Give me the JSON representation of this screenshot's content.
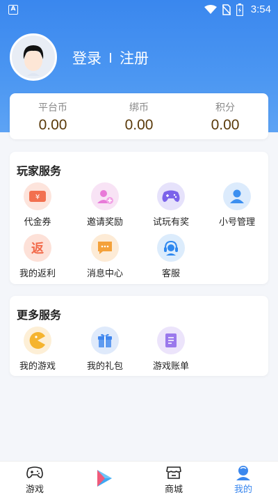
{
  "status_bar": {
    "app_badge": "A",
    "time": "3:54"
  },
  "header": {
    "login_label": "登录",
    "register_label": "注册"
  },
  "wallet": {
    "items": [
      {
        "label": "平台币",
        "value": "0.00"
      },
      {
        "label": "绑币",
        "value": "0.00"
      },
      {
        "label": "积分",
        "value": "0.00"
      }
    ]
  },
  "player_services": {
    "title": "玩家服务",
    "items": [
      {
        "label": "代金券",
        "icon": "voucher-icon",
        "glyph": "¥"
      },
      {
        "label": "邀请奖励",
        "icon": "invite-user-icon"
      },
      {
        "label": "试玩有奖",
        "icon": "gamepad-icon"
      },
      {
        "label": "小号管理",
        "icon": "sub-account-icon"
      },
      {
        "label": "我的返利",
        "icon": "rebate-icon",
        "glyph": "返"
      },
      {
        "label": "消息中心",
        "icon": "message-icon"
      },
      {
        "label": "客服",
        "icon": "customer-service-icon"
      }
    ]
  },
  "more_services": {
    "title": "更多服务",
    "items": [
      {
        "label": "我的游戏",
        "icon": "my-games-icon"
      },
      {
        "label": "我的礼包",
        "icon": "gift-icon"
      },
      {
        "label": "游戏账单",
        "icon": "bill-icon"
      }
    ]
  },
  "tab_bar": {
    "active_color": "#3a87ee",
    "tabs": [
      {
        "label": "游戏",
        "icon": "gamepad-icon"
      },
      {
        "label": "",
        "icon": "play-logo-icon"
      },
      {
        "label": "商城",
        "icon": "shop-icon"
      },
      {
        "label": "我的",
        "icon": "profile-icon",
        "active": true
      }
    ]
  }
}
